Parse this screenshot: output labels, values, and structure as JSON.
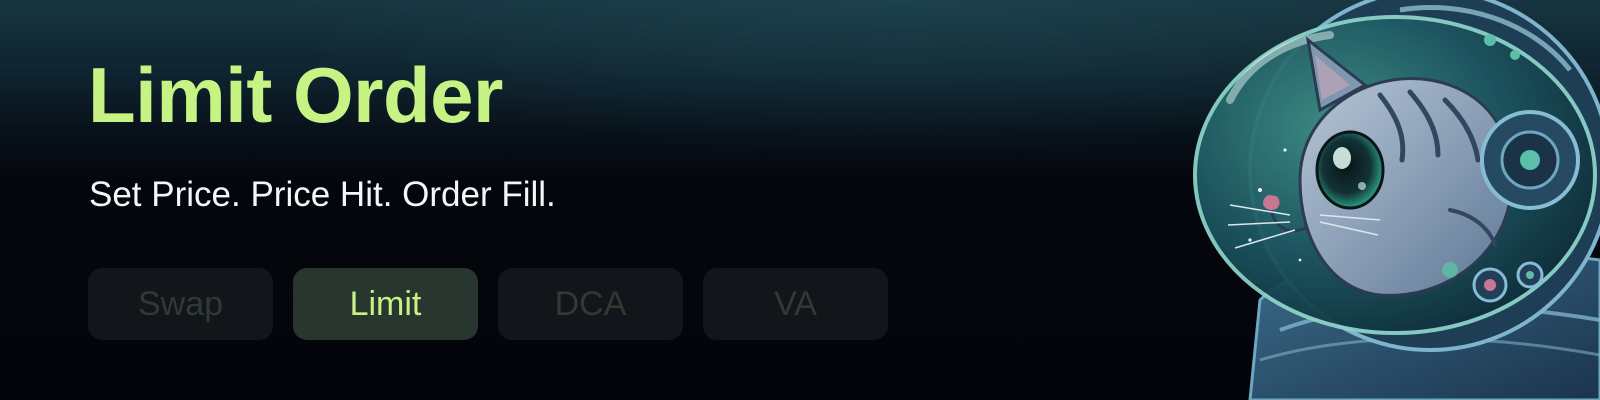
{
  "banner": {
    "title": "Limit Order",
    "subtitle": "Set Price. Price Hit. Order Fill."
  },
  "tabs": [
    {
      "label": "Swap",
      "active": false
    },
    {
      "label": "Limit",
      "active": true
    },
    {
      "label": "DCA",
      "active": false
    },
    {
      "label": "VA",
      "active": false
    }
  ],
  "colors": {
    "accent": "#c7f284",
    "inactive_tab_text": "#2f3a33",
    "active_tab_bg": "#29362f",
    "tab_bg": "#121519",
    "subtitle": "#f4f6f8"
  },
  "illustration": {
    "icon": "astronaut-cat-icon"
  }
}
